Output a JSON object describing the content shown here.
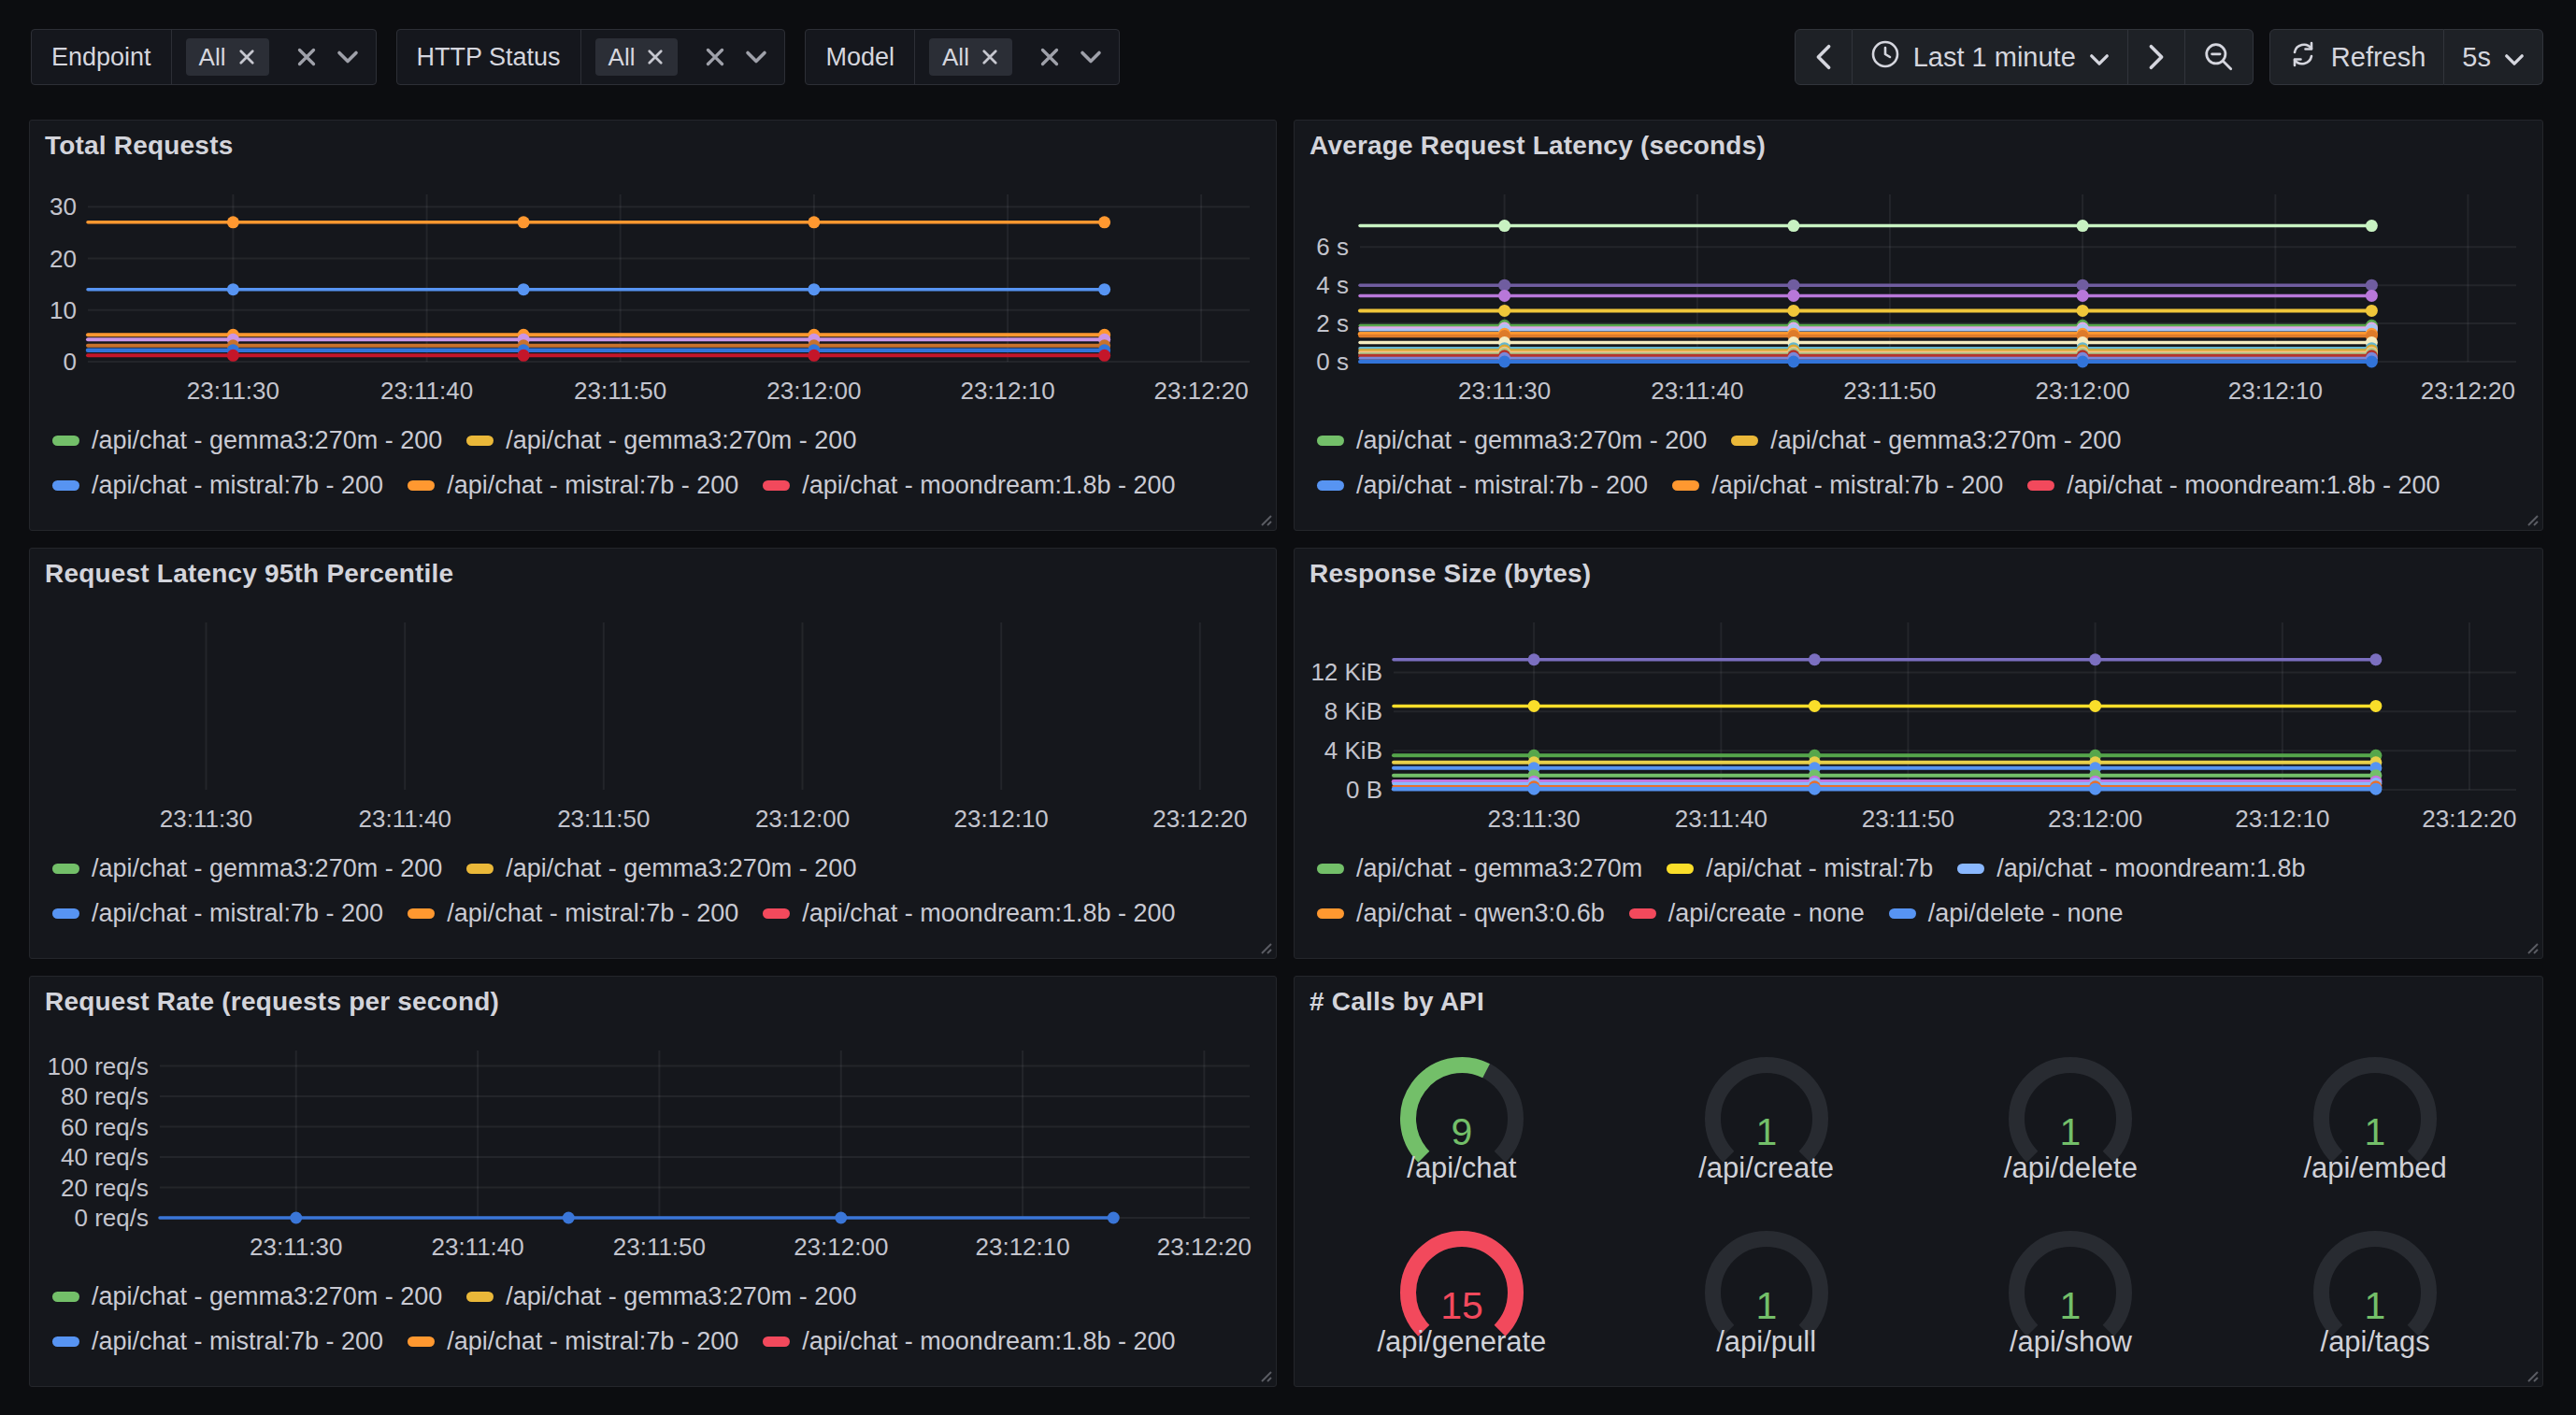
{
  "toolbar": {
    "filters": [
      {
        "label": "Endpoint",
        "value": "All"
      },
      {
        "label": "HTTP Status",
        "value": "All"
      },
      {
        "label": "Model",
        "value": "All"
      }
    ],
    "time_range": {
      "label": "Last 1 minute"
    },
    "refresh": {
      "label": "Refresh",
      "interval": "5s"
    }
  },
  "colors": {
    "page_bg": "#0c0d10",
    "panel_bg": "#15171c",
    "green": "#73BF69",
    "red": "#F2495C",
    "grid": "rgba(204,204,220,0.08)",
    "axis_text": "#c3c4cd"
  },
  "x_axis": {
    "ticks": [
      "23:11:30",
      "23:11:40",
      "23:11:50",
      "23:12:00",
      "23:12:10",
      "23:12:20"
    ],
    "tick_fractions": [
      0.125,
      0.2917,
      0.4583,
      0.625,
      0.7917,
      0.9583
    ],
    "point_times": [
      "23:11:30",
      "23:11:45",
      "23:12:00",
      "23:12:15"
    ],
    "point_fractions": [
      0.125,
      0.375,
      0.625,
      0.875
    ]
  },
  "legend_requests": [
    [
      {
        "color": "#73BF69",
        "label": "/api/chat - gemma3:270m - 200"
      },
      {
        "color": "#EAB839",
        "label": "/api/chat - gemma3:270m - 200"
      }
    ],
    [
      {
        "color": "#5794F2",
        "label": "/api/chat - mistral:7b - 200"
      },
      {
        "color": "#FF9830",
        "label": "/api/chat - mistral:7b - 200"
      },
      {
        "color": "#F2495C",
        "label": "/api/chat - moondream:1.8b - 200"
      }
    ]
  ],
  "legend_size": [
    [
      {
        "color": "#73BF69",
        "label": "/api/chat - gemma3:270m"
      },
      {
        "color": "#FADE2A",
        "label": "/api/chat - mistral:7b"
      },
      {
        "color": "#8AB8FF",
        "label": "/api/chat - moondream:1.8b"
      }
    ],
    [
      {
        "color": "#FF9830",
        "label": "/api/chat - qwen3:0.6b"
      },
      {
        "color": "#F2495C",
        "label": "/api/create - none"
      },
      {
        "color": "#5794F2",
        "label": "/api/delete - none"
      }
    ]
  ],
  "panels": [
    {
      "id": "total-requests",
      "title": "Total Requests",
      "type": "line",
      "y_ticks": [
        {
          "v": 0,
          "label": "0"
        },
        {
          "v": 10,
          "label": "10"
        },
        {
          "v": 20,
          "label": "20"
        },
        {
          "v": 30,
          "label": "30"
        }
      ],
      "y_axis_max": 32.4,
      "series": [
        {
          "color": "#FF9830",
          "value": 27,
          "width": 3.5
        },
        {
          "color": "#5794F2",
          "value": 14,
          "width": 3.5
        },
        {
          "color": "#FF9830",
          "value": 5.2,
          "width": 4
        },
        {
          "color": "#CA95E5",
          "value": 4.3,
          "width": 4
        },
        {
          "color": "#C8722C",
          "value": 3.1,
          "width": 4
        },
        {
          "color": "#3274D9",
          "value": 2.2,
          "width": 4.5
        },
        {
          "color": "#C4162A",
          "value": 1.2,
          "width": 4
        }
      ],
      "legend_ref": "legend_requests"
    },
    {
      "id": "avg-latency",
      "title": "Average Request Latency (seconds)",
      "type": "line",
      "y_ticks": [
        {
          "v": 0,
          "label": "0 s"
        },
        {
          "v": 2,
          "label": "2 s"
        },
        {
          "v": 4,
          "label": "4 s"
        },
        {
          "v": 6,
          "label": "6 s"
        }
      ],
      "y_axis_max": 8.75,
      "series": [
        {
          "color": "#C8F2C2",
          "value": 7.11,
          "width": 3.5
        },
        {
          "color": "#705DA0",
          "value": 4.0,
          "width": 3.5
        },
        {
          "color": "#B877D9",
          "value": 3.45,
          "width": 3.5
        },
        {
          "color": "#F0C63A",
          "value": 2.67,
          "width": 4
        },
        {
          "color": "#56A64B",
          "value": 1.89,
          "width": 3
        },
        {
          "color": "#E2A8E8",
          "value": 1.76,
          "width": 3.5
        },
        {
          "color": "#A8C5F2",
          "value": 1.66,
          "width": 3
        },
        {
          "color": "#FF9830",
          "value": 1.45,
          "width": 4.5
        },
        {
          "color": "#DD7B2A",
          "value": 1.34,
          "width": 3.5
        },
        {
          "color": "#F5ECC0",
          "value": 1.0,
          "width": 3.5
        },
        {
          "color": "#64B6CE",
          "value": 0.7,
          "width": 3.5
        },
        {
          "color": "#D9A82F",
          "value": 0.59,
          "width": 3.5
        },
        {
          "color": "#F7C489",
          "value": 0.48,
          "width": 3.5
        },
        {
          "color": "#AFC98A",
          "value": 0.41,
          "width": 3
        },
        {
          "color": "#B5342B",
          "value": 0.3,
          "width": 4
        },
        {
          "color": "#7B88D9",
          "value": 0.18,
          "width": 3
        },
        {
          "color": "#3274D9",
          "value": 0.0,
          "width": 4
        }
      ],
      "legend_ref": "legend_requests"
    },
    {
      "id": "latency-95th",
      "title": "Request Latency 95th Percentile",
      "type": "line",
      "y_ticks": [],
      "y_axis_max": 1,
      "series": [],
      "legend_ref": "legend_requests"
    },
    {
      "id": "response-size",
      "title": "Response Size (bytes)",
      "type": "line",
      "y_ticks": [
        {
          "v": 0,
          "label": "0 B"
        },
        {
          "v": 4,
          "label": "4 KiB"
        },
        {
          "v": 8,
          "label": "8 KiB"
        },
        {
          "v": 12,
          "label": "12 KiB"
        }
      ],
      "y_axis_max": 17.1,
      "series": [
        {
          "color": "#7B6FC0",
          "value": 13.3,
          "width": 3.5
        },
        {
          "color": "#FADE2A",
          "value": 8.56,
          "width": 3.5
        },
        {
          "color": "#56A64B",
          "value": 3.51,
          "width": 4
        },
        {
          "color": "#E8D04B",
          "value": 2.79,
          "width": 4
        },
        {
          "color": "#5794F2",
          "value": 2.22,
          "width": 4
        },
        {
          "color": "#73BF69",
          "value": 1.46,
          "width": 4
        },
        {
          "color": "#C573DE",
          "value": 0.84,
          "width": 4.5
        },
        {
          "color": "#8AB8FF",
          "value": 0.61,
          "width": 3.5
        },
        {
          "color": "#E8702E",
          "value": 0.3,
          "width": 3.5
        },
        {
          "color": "#5794F2",
          "value": 0.08,
          "width": 4.5
        }
      ],
      "legend_ref": "legend_size"
    },
    {
      "id": "request-rate",
      "title": "Request Rate (requests per second)",
      "type": "line",
      "y_ticks": [
        {
          "v": 0,
          "label": "0 req/s"
        },
        {
          "v": 20,
          "label": "20 req/s"
        },
        {
          "v": 40,
          "label": "40 req/s"
        },
        {
          "v": 60,
          "label": "60 req/s"
        },
        {
          "v": 80,
          "label": "80 req/s"
        },
        {
          "v": 100,
          "label": "100 req/s"
        }
      ],
      "y_axis_max": 110.2,
      "series": [
        {
          "color": "#3A76D8",
          "value": 0,
          "width": 3.5
        }
      ],
      "legend_ref": "legend_requests"
    },
    {
      "id": "calls-by-api",
      "title": "# Calls by API",
      "type": "gauge",
      "gauge_min": 0,
      "gauge_max": 15,
      "gauges": [
        {
          "label": "/api/chat",
          "value": 9,
          "color": "#73BF69",
          "fill": 0.6
        },
        {
          "label": "/api/create",
          "value": 1,
          "color": "#73BF69",
          "fill": 0
        },
        {
          "label": "/api/delete",
          "value": 1,
          "color": "#73BF69",
          "fill": 0
        },
        {
          "label": "/api/embed",
          "value": 1,
          "color": "#73BF69",
          "fill": 0
        },
        {
          "label": "/api/generate",
          "value": 15,
          "color": "#F2495C",
          "fill": 1
        },
        {
          "label": "/api/pull",
          "value": 1,
          "color": "#73BF69",
          "fill": 0
        },
        {
          "label": "/api/show",
          "value": 1,
          "color": "#73BF69",
          "fill": 0
        },
        {
          "label": "/api/tags",
          "value": 1,
          "color": "#73BF69",
          "fill": 0
        }
      ]
    }
  ],
  "chart_data": [
    {
      "type": "line",
      "title": "Total Requests",
      "x": [
        "23:11:30",
        "23:11:45",
        "23:12:00",
        "23:12:15"
      ],
      "ylim": [
        0,
        32.4
      ],
      "yticks": [
        0,
        10,
        20,
        30
      ],
      "series": [
        {
          "color": "#FF9830",
          "values": [
            27,
            27,
            27,
            27
          ]
        },
        {
          "color": "#5794F2",
          "values": [
            14,
            14,
            14,
            14
          ]
        },
        {
          "color": "#FF9830",
          "values": [
            5,
            5,
            5,
            5
          ]
        },
        {
          "color": "#CA95E5",
          "values": [
            4,
            4,
            4,
            4
          ]
        },
        {
          "color": "#C8722C",
          "values": [
            3,
            3,
            3,
            3
          ]
        },
        {
          "color": "#3274D9",
          "values": [
            2,
            2,
            2,
            2
          ]
        },
        {
          "color": "#C4162A",
          "values": [
            1,
            1,
            1,
            1
          ]
        }
      ]
    },
    {
      "type": "line",
      "title": "Average Request Latency (seconds)",
      "x": [
        "23:11:30",
        "23:11:45",
        "23:12:00",
        "23:12:15"
      ],
      "ylim": [
        0,
        8.75
      ],
      "yticks": [
        0,
        2,
        4,
        6
      ],
      "y_unit": "s",
      "series": [
        {
          "color": "#C8F2C2",
          "values": [
            7.1,
            7.1,
            7.1,
            7.1
          ]
        },
        {
          "color": "#705DA0",
          "values": [
            4,
            4,
            4,
            4
          ]
        },
        {
          "color": "#B877D9",
          "values": [
            3.45,
            3.45,
            3.45,
            3.45
          ]
        },
        {
          "color": "#F0C63A",
          "values": [
            2.67,
            2.67,
            2.67,
            2.67
          ]
        },
        {
          "color": "#FF9830",
          "values": [
            1.45,
            1.45,
            1.45,
            1.45
          ]
        },
        {
          "color": "#64B6CE",
          "values": [
            0.7,
            0.7,
            0.7,
            0.7
          ]
        },
        {
          "color": "#B5342B",
          "values": [
            0.3,
            0.3,
            0.3,
            0.3
          ]
        },
        {
          "color": "#3274D9",
          "values": [
            0.02,
            0.02,
            0.02,
            0.02
          ]
        }
      ]
    },
    {
      "type": "line",
      "title": "Request Latency 95th Percentile",
      "x": [
        "23:11:30",
        "23:11:45",
        "23:12:00",
        "23:12:15"
      ],
      "series": []
    },
    {
      "type": "line",
      "title": "Response Size (bytes)",
      "x": [
        "23:11:30",
        "23:11:45",
        "23:12:00",
        "23:12:15"
      ],
      "ylim": [
        0,
        17.1
      ],
      "yticks": [
        0,
        4,
        8,
        12
      ],
      "y_unit": "KiB",
      "series": [
        {
          "color": "#7B6FC0",
          "values": [
            13.3,
            13.3,
            13.3,
            13.3
          ]
        },
        {
          "color": "#FADE2A",
          "values": [
            8.56,
            8.56,
            8.56,
            8.56
          ]
        },
        {
          "color": "#56A64B",
          "values": [
            3.51,
            3.51,
            3.51,
            3.51
          ]
        },
        {
          "color": "#5794F2",
          "values": [
            2.22,
            2.22,
            2.22,
            2.22
          ]
        },
        {
          "color": "#C573DE",
          "values": [
            0.84,
            0.84,
            0.84,
            0.84
          ]
        }
      ]
    },
    {
      "type": "line",
      "title": "Request Rate (requests per second)",
      "x": [
        "23:11:30",
        "23:11:45",
        "23:12:00",
        "23:12:15"
      ],
      "ylim": [
        0,
        110.2
      ],
      "yticks": [
        0,
        20,
        40,
        60,
        80,
        100
      ],
      "y_unit": "req/s",
      "series": [
        {
          "color": "#3274D9",
          "values": [
            0,
            0,
            0,
            0
          ]
        }
      ]
    },
    {
      "type": "gauge",
      "title": "# Calls by API",
      "categories": [
        "/api/chat",
        "/api/create",
        "/api/delete",
        "/api/embed",
        "/api/generate",
        "/api/pull",
        "/api/show",
        "/api/tags"
      ],
      "values": [
        9,
        1,
        1,
        1,
        15,
        1,
        1,
        1
      ],
      "min": 0,
      "max": 15
    }
  ]
}
